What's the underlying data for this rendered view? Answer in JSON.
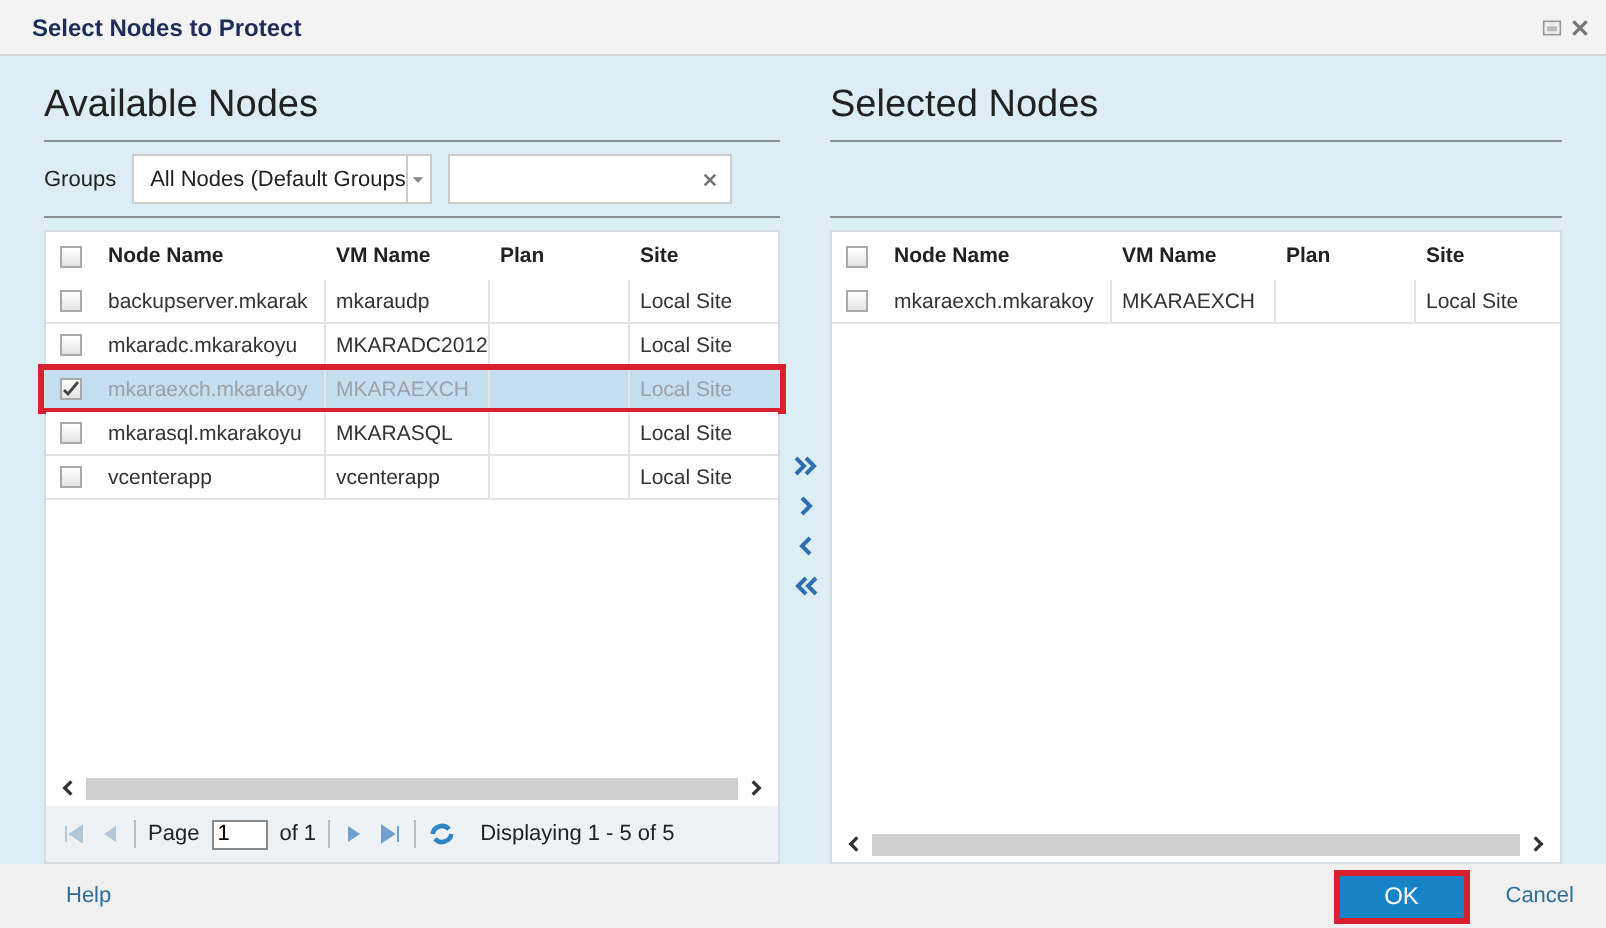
{
  "window": {
    "title": "Select Nodes to Protect"
  },
  "available": {
    "title": "Available Nodes",
    "groups_label": "Groups",
    "groups_value": "All Nodes (Default Groups",
    "columns": [
      "Node Name",
      "VM Name",
      "Plan",
      "Site"
    ],
    "all_checked": false,
    "rows": [
      {
        "node": "backupserver.mkarak",
        "vm": "mkaraudp",
        "site": "Local Site",
        "checked": false,
        "selected": false
      },
      {
        "node": "mkaradc.mkarakoyu",
        "vm": "MKARADC2012",
        "site": "Local Site",
        "checked": false,
        "selected": false
      },
      {
        "node": "mkaraexch.mkarakoy",
        "vm": "MKARAEXCH",
        "site": "Local Site",
        "checked": true,
        "selected": true
      },
      {
        "node": "mkarasql.mkarakoyu",
        "vm": "MKARASQL",
        "site": "Local Site",
        "checked": false,
        "selected": false
      },
      {
        "node": "vcenterapp",
        "vm": "vcenterapp",
        "site": "Local Site",
        "checked": false,
        "selected": false
      }
    ],
    "pager": {
      "page_label": "Page",
      "page": "1",
      "of": "of 1",
      "display": "Displaying 1 - 5 of 5"
    }
  },
  "selected_panel": {
    "title": "Selected Nodes",
    "columns": [
      "Node Name",
      "VM Name",
      "Plan",
      "Site"
    ],
    "all_checked": false,
    "rows": [
      {
        "node": "mkaraexch.mkarakoy",
        "vm": "MKARAEXCH",
        "site": "Local Site",
        "checked": false,
        "selected": false
      }
    ]
  },
  "footer": {
    "help": "Help",
    "ok": "OK",
    "ok_highlighted": true,
    "cancel": "Cancel"
  }
}
